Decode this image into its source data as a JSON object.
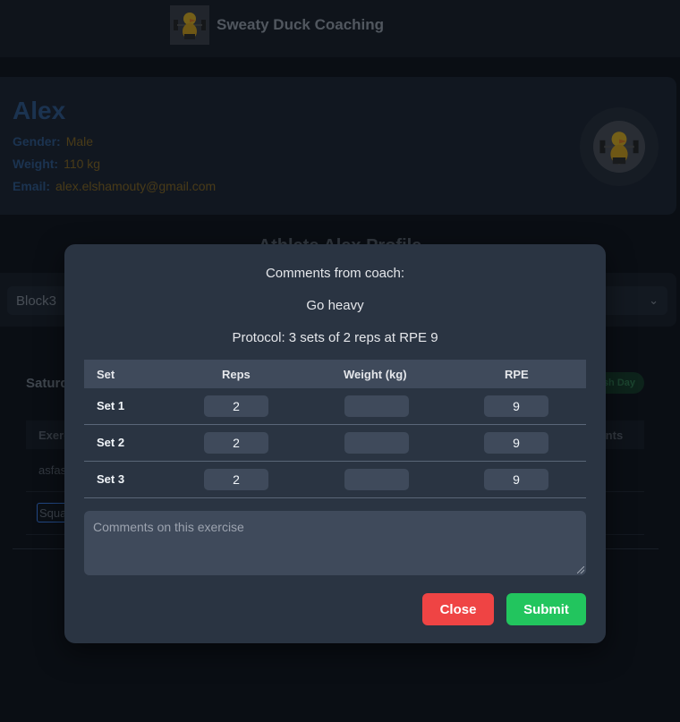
{
  "header": {
    "brand_name": "Sweaty Duck Coaching"
  },
  "athlete": {
    "name": "Alex",
    "gender_label": "Gender:",
    "gender": "Male",
    "weight_label": "Weight:",
    "weight": "110 kg",
    "email_label": "Email:",
    "email": "alex.elshamouty@gmail.com"
  },
  "page": {
    "section_title": "Athlete Alex Profile"
  },
  "program": {
    "block": "Block3"
  },
  "day": {
    "title": "Saturday",
    "finish_label": "Finish Day",
    "headers": {
      "exercise": "Exercise",
      "comments": "Comments"
    },
    "rows": [
      {
        "name": "asfas"
      },
      {
        "name": "Squat"
      }
    ]
  },
  "modal": {
    "comments_heading": "Comments from coach:",
    "coach_comment": "Go heavy",
    "protocol": "Protocol: 3 sets of 2 reps at RPE 9",
    "columns": {
      "set": "Set",
      "reps": "Reps",
      "weight": "Weight (kg)",
      "rpe": "RPE"
    },
    "sets": [
      {
        "label": "Set 1",
        "reps": "2",
        "weight": "",
        "rpe": "9"
      },
      {
        "label": "Set 2",
        "reps": "2",
        "weight": "",
        "rpe": "9"
      },
      {
        "label": "Set 3",
        "reps": "2",
        "weight": "",
        "rpe": "9"
      }
    ],
    "comments_placeholder": "Comments on this exercise",
    "close_label": "Close",
    "submit_label": "Submit"
  },
  "colors": {
    "close": "#ef4444",
    "submit": "#22c55e",
    "modal_bg": "#2a3442"
  }
}
